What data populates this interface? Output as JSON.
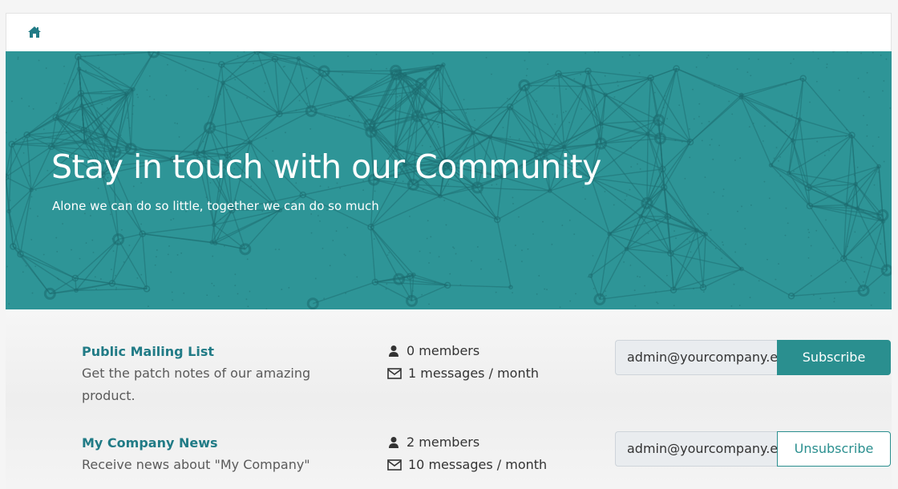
{
  "nav": {
    "home_icon": "home-icon"
  },
  "hero": {
    "title": "Stay in touch with our Community",
    "subtitle": "Alone we can do so little, together we can do so much",
    "background_color": "#2e9597"
  },
  "lists": [
    {
      "title": "Public Mailing List",
      "description": "Get the patch notes of our amazing product.",
      "members": "0 members",
      "messages": "1 messages / month",
      "email": "admin@yourcompany.example.com",
      "action_label": "Subscribe"
    },
    {
      "title": "My Company News",
      "description": "Receive news about \"My Company\"",
      "members": "2 members",
      "messages": "10 messages / month",
      "email": "admin@yourcompany.example.com",
      "action_label": "Unsubscribe"
    }
  ],
  "colors": {
    "accent": "#2a8f8f",
    "title": "#217b86"
  }
}
